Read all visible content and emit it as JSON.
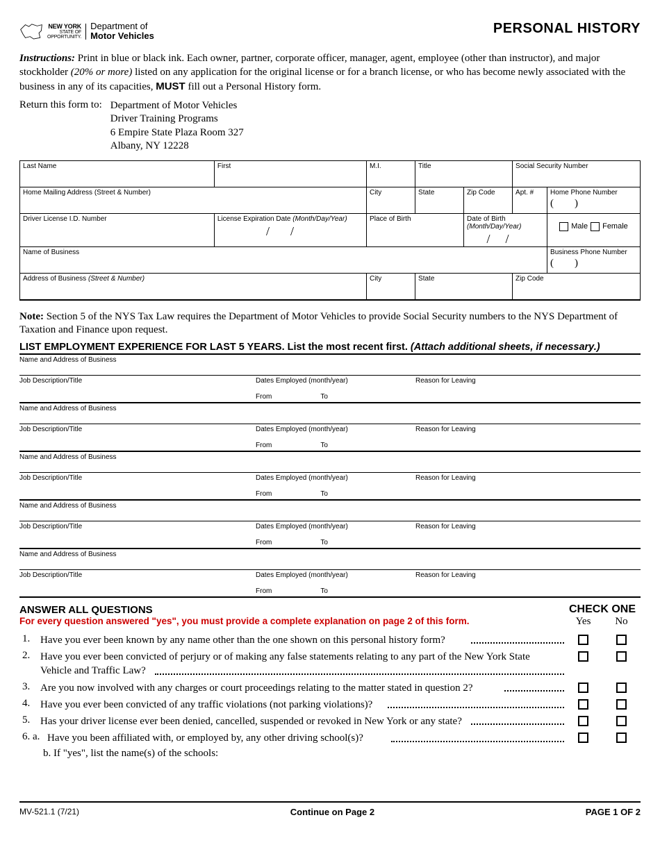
{
  "header": {
    "state_top": "NEW YORK",
    "state_mid": "STATE OF",
    "state_bot": "OPPORTUNITY.",
    "dept_l1": "Department of",
    "dept_l2": "Motor Vehicles",
    "title": "PERSONAL HISTORY"
  },
  "instructions": {
    "lead": "Instructions:",
    "body1": " Print in blue or black ink. Each owner, partner, corporate officer, manager, agent, employee (other than instructor), and major stockholder ",
    "italic1": "(20% or more)",
    "body2": " listed on any application for the original license or for a branch license, or who has become newly associated with the business in any of its capacities, ",
    "must": "MUST",
    "body3": " fill out a Personal History form."
  },
  "return": {
    "label": "Return this form to:",
    "l1": "Department of Motor Vehicles",
    "l2": "Driver Training Programs",
    "l3": "6 Empire State Plaza Room 327",
    "l4": "Albany, NY  12228"
  },
  "fields": {
    "last_name": "Last Name",
    "first": "First",
    "mi": "M.I.",
    "title_f": "Title",
    "ssn": "Social Security Number",
    "home_addr": "Home Mailing Address (Street & Number)",
    "city": "City",
    "state": "State",
    "zip": "Zip Code",
    "apt": "Apt. #",
    "home_phone": "Home Phone Number",
    "dlid": "Driver License I.D. Number",
    "lic_exp": "License Expiration Date ",
    "lic_exp_fmt": "(Month/Day/Year)",
    "pob": "Place of Birth",
    "dob": "Date of Birth ",
    "dob_fmt": "(Month/Day/Year)",
    "male": "Male",
    "female": "Female",
    "biz_name": "Name of Business",
    "biz_phone": "Business Phone Number",
    "biz_addr": "Address of Business ",
    "biz_addr_fmt": "(Street & Number)"
  },
  "note": {
    "lead": "Note:",
    "body": " Section 5 of the NYS Tax Law requires the Department of Motor Vehicles to provide Social Security numbers to the NYS Department of Taxation and Finance upon request."
  },
  "emp_section": {
    "head1": "LIST EMPLOYMENT EXPERIENCE FOR LAST 5 YEARS",
    "head2": ". List the most recent first. ",
    "head3": "(Attach additional sheets, if necessary.)",
    "name_addr": "Name and Address of Business",
    "job_title": "Job Description/Title",
    "dates": "Dates Employed (month/year)",
    "reason": "Reason for Leaving",
    "from": "From",
    "to": "To"
  },
  "answers": {
    "head": "ANSWER ALL QUESTIONS",
    "check_one": "CHECK ONE",
    "red": "For every question answered \"yes\", you must provide a complete explanation on page 2 of this form.",
    "yes": "Yes",
    "no": "No",
    "q1n": "1.",
    "q1": "Have you ever been known by any name other than the one shown on this personal history form?",
    "q2n": "2.",
    "q2a": "Have you ever been convicted of perjury or of making any false statements relating to any part of the New York State",
    "q2b": "Vehicle and Traffic Law?",
    "q3n": "3.",
    "q3": "Are you now involved with any charges or court proceedings relating to the matter stated in question 2?",
    "q4n": "4.",
    "q4": "Have you ever been convicted of any traffic violations (not parking violations)?",
    "q5n": "5.",
    "q5": "Has your driver license ever been denied, cancelled, suspended or revoked in New York or any state?",
    "q6n": "6. a.",
    "q6a": "Have you been affiliated with, or employed by, any other driving school(s)?",
    "q6bn": "b.",
    "q6b": " If \"yes\", list the name(s) of the schools:"
  },
  "footer": {
    "form_id": "MV-521.1 (7/21)",
    "continue": "Continue on Page 2",
    "page": "PAGE 1 OF 2"
  }
}
